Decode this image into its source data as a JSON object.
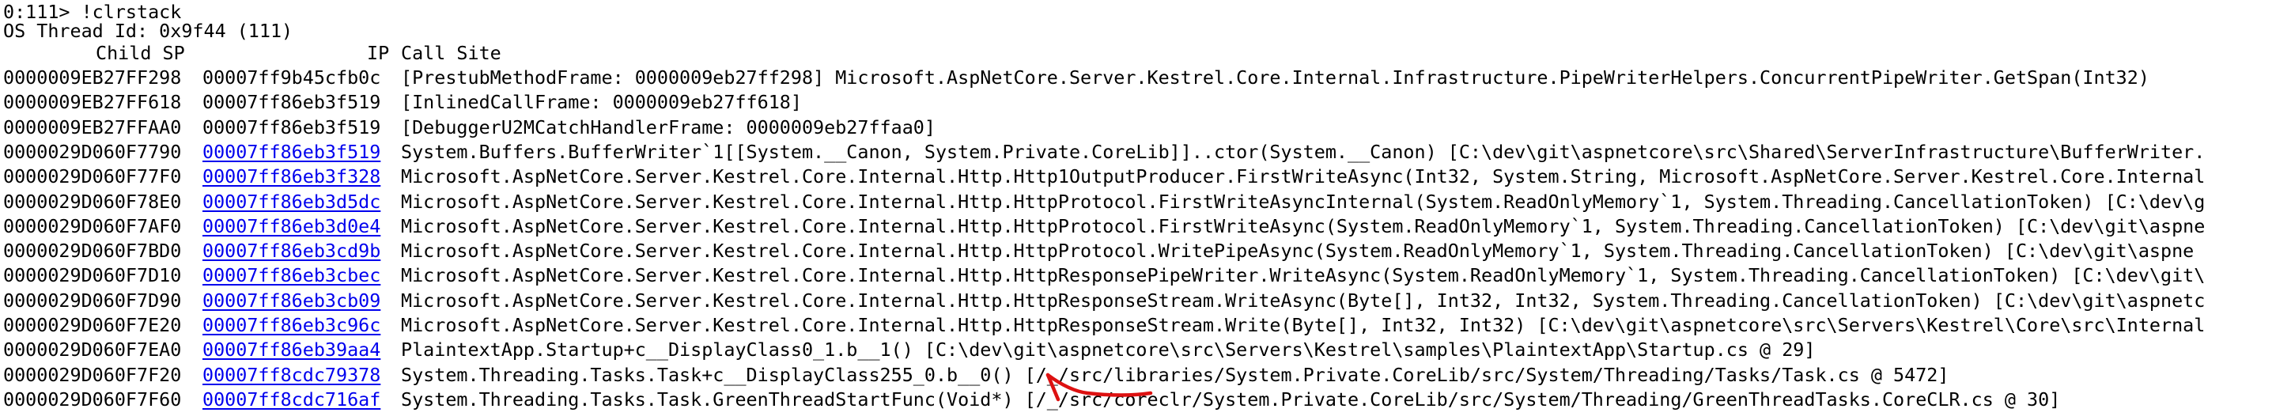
{
  "console": {
    "prompt": "0:111> !clrstack",
    "os_thread": "OS Thread Id: 0x9f44 (111)",
    "header": {
      "child_sp": "Child SP",
      "ip": "IP",
      "call_site": "Call Site"
    },
    "frames": [
      {
        "sp": "0000009EB27FF298",
        "ip": "00007ff9b45cfb0c",
        "ip_link": false,
        "call": "[PrestubMethodFrame: 0000009eb27ff298] Microsoft.AspNetCore.Server.Kestrel.Core.Internal.Infrastructure.PipeWriterHelpers.ConcurrentPipeWriter.GetSpan(Int32)"
      },
      {
        "sp": "0000009EB27FF618",
        "ip": "00007ff86eb3f519",
        "ip_link": false,
        "call": "[InlinedCallFrame: 0000009eb27ff618]"
      },
      {
        "sp": "0000009EB27FFAA0",
        "ip": "00007ff86eb3f519",
        "ip_link": false,
        "call": "[DebuggerU2MCatchHandlerFrame: 0000009eb27ffaa0]"
      },
      {
        "sp": "0000029D060F7790",
        "ip": "00007ff86eb3f519",
        "ip_link": true,
        "call": "System.Buffers.BufferWriter`1[[System.__Canon, System.Private.CoreLib]]..ctor(System.__Canon) [C:\\dev\\git\\aspnetcore\\src\\Shared\\ServerInfrastructure\\BufferWriter."
      },
      {
        "sp": "0000029D060F77F0",
        "ip": "00007ff86eb3f328",
        "ip_link": true,
        "call": "Microsoft.AspNetCore.Server.Kestrel.Core.Internal.Http.Http1OutputProducer.FirstWriteAsync(Int32, System.String, Microsoft.AspNetCore.Server.Kestrel.Core.Internal"
      },
      {
        "sp": "0000029D060F78E0",
        "ip": "00007ff86eb3d5dc",
        "ip_link": true,
        "call": "Microsoft.AspNetCore.Server.Kestrel.Core.Internal.Http.HttpProtocol.FirstWriteAsyncInternal(System.ReadOnlyMemory`1, System.Threading.CancellationToken) [C:\\dev\\g"
      },
      {
        "sp": "0000029D060F7AF0",
        "ip": "00007ff86eb3d0e4",
        "ip_link": true,
        "call": "Microsoft.AspNetCore.Server.Kestrel.Core.Internal.Http.HttpProtocol.FirstWriteAsync(System.ReadOnlyMemory`1, System.Threading.CancellationToken) [C:\\dev\\git\\aspne"
      },
      {
        "sp": "0000029D060F7BD0",
        "ip": "00007ff86eb3cd9b",
        "ip_link": true,
        "call": "Microsoft.AspNetCore.Server.Kestrel.Core.Internal.Http.HttpProtocol.WritePipeAsync(System.ReadOnlyMemory`1, System.Threading.CancellationToken) [C:\\dev\\git\\aspne"
      },
      {
        "sp": "0000029D060F7D10",
        "ip": "00007ff86eb3cbec",
        "ip_link": true,
        "call": "Microsoft.AspNetCore.Server.Kestrel.Core.Internal.Http.HttpResponsePipeWriter.WriteAsync(System.ReadOnlyMemory`1, System.Threading.CancellationToken) [C:\\dev\\git\\"
      },
      {
        "sp": "0000029D060F7D90",
        "ip": "00007ff86eb3cb09",
        "ip_link": true,
        "call": "Microsoft.AspNetCore.Server.Kestrel.Core.Internal.Http.HttpResponseStream.WriteAsync(Byte[], Int32, Int32, System.Threading.CancellationToken) [C:\\dev\\git\\aspnetc"
      },
      {
        "sp": "0000029D060F7E20",
        "ip": "00007ff86eb3c96c",
        "ip_link": true,
        "call": "Microsoft.AspNetCore.Server.Kestrel.Core.Internal.Http.HttpResponseStream.Write(Byte[], Int32, Int32) [C:\\dev\\git\\aspnetcore\\src\\Servers\\Kestrel\\Core\\src\\Internal"
      },
      {
        "sp": "0000029D060F7EA0",
        "ip": "00007ff86eb39aa4",
        "ip_link": true,
        "call": "PlaintextApp.Startup+c__DisplayClass0_1.b__1() [C:\\dev\\git\\aspnetcore\\src\\Servers\\Kestrel\\samples\\PlaintextApp\\Startup.cs @ 29]"
      },
      {
        "sp": "0000029D060F7F20",
        "ip": "00007ff8cdc79378",
        "ip_link": true,
        "call": "System.Threading.Tasks.Task+c__DisplayClass255_0.b__0() [/_/src/libraries/System.Private.CoreLib/src/System/Threading/Tasks/Task.cs @ 5472]"
      },
      {
        "sp": "0000029D060F7F60",
        "ip": "00007ff8cdc716af",
        "ip_link": true,
        "call": "System.Threading.Tasks.Task.GreenThreadStartFunc(Void*) [/_/src/coreclr/System.Private.CoreLib/src/System/Threading/GreenThreadTasks.CoreCLR.cs @ 30]"
      }
    ]
  },
  "colors": {
    "background": "#ffffff",
    "text": "#000000",
    "link": "#0000ee",
    "annotation_arrow": "#dd1111"
  }
}
